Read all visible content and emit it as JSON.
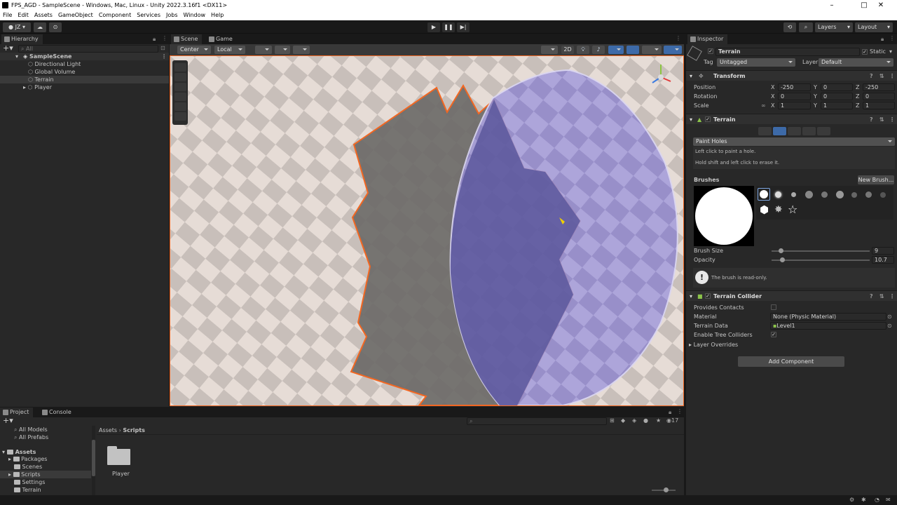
{
  "window": {
    "title": "FPS_AGD - SampleScene - Windows, Mac, Linux - Unity 2022.3.16f1 <DX11>"
  },
  "menu": [
    "File",
    "Edit",
    "Assets",
    "GameObject",
    "Component",
    "Services",
    "Jobs",
    "Window",
    "Help"
  ],
  "toolbar": {
    "account": "JZ",
    "layers": "Layers",
    "layout": "Layout"
  },
  "hierarchy": {
    "tab": "Hierarchy",
    "search_placeholder": "All",
    "scene": "SampleScene",
    "items": [
      "Directional Light",
      "Global Volume",
      "Terrain",
      "Player"
    ]
  },
  "scene_view": {
    "tabs": [
      "Scene",
      "Game"
    ],
    "pivot": "Center",
    "space": "Local",
    "mode_2d": "2D"
  },
  "inspector": {
    "tab": "Inspector",
    "object_name": "Terrain",
    "static_label": "Static",
    "tag_label": "Tag",
    "tag_value": "Untagged",
    "layer_label": "Layer",
    "layer_value": "Default",
    "transform": {
      "title": "Transform",
      "rows": [
        {
          "label": "Position",
          "x": "-250",
          "y": "0",
          "z": "-250"
        },
        {
          "label": "Rotation",
          "x": "0",
          "y": "0",
          "z": "0"
        },
        {
          "label": "Scale",
          "x": "1",
          "y": "1",
          "z": "1"
        }
      ],
      "axis": [
        "X",
        "Y",
        "Z"
      ]
    },
    "terrain": {
      "title": "Terrain",
      "tool": "Paint Holes",
      "help1": "Left click to paint a hole.",
      "help2": "Hold shift and left click to erase it.",
      "brushes_label": "Brushes",
      "new_brush": "New Brush...",
      "brush_size_label": "Brush Size",
      "brush_size": "9",
      "brush_size_frac": 0.09,
      "opacity_label": "Opacity",
      "opacity": "10.7",
      "opacity_frac": 0.107,
      "readonly_msg": "The brush is read-only."
    },
    "collider": {
      "title": "Terrain Collider",
      "rows": [
        {
          "label": "Provides Contacts",
          "value": ""
        },
        {
          "label": "Material",
          "value": "None (Physic Material)"
        },
        {
          "label": "Terrain Data",
          "value": "Level1"
        },
        {
          "label": "Enable Tree Colliders",
          "value": "✓"
        }
      ],
      "overrides": "Layer Overrides"
    },
    "add_component": "Add Component"
  },
  "project": {
    "tabs": [
      "Project",
      "Console"
    ],
    "favorites": [
      "All Models",
      "All Prefabs"
    ],
    "assets_root": "Assets",
    "folders": [
      "Packages",
      "Scenes",
      "Scripts",
      "Settings",
      "Terrain"
    ],
    "breadcrumb": [
      "Assets",
      "Scripts"
    ],
    "files": [
      "Player"
    ],
    "hidden_count": "17"
  },
  "colors": {
    "accent": "#3d6aa8",
    "selection_outline": "#f26722",
    "hole_overlay": "#8c84d6"
  }
}
